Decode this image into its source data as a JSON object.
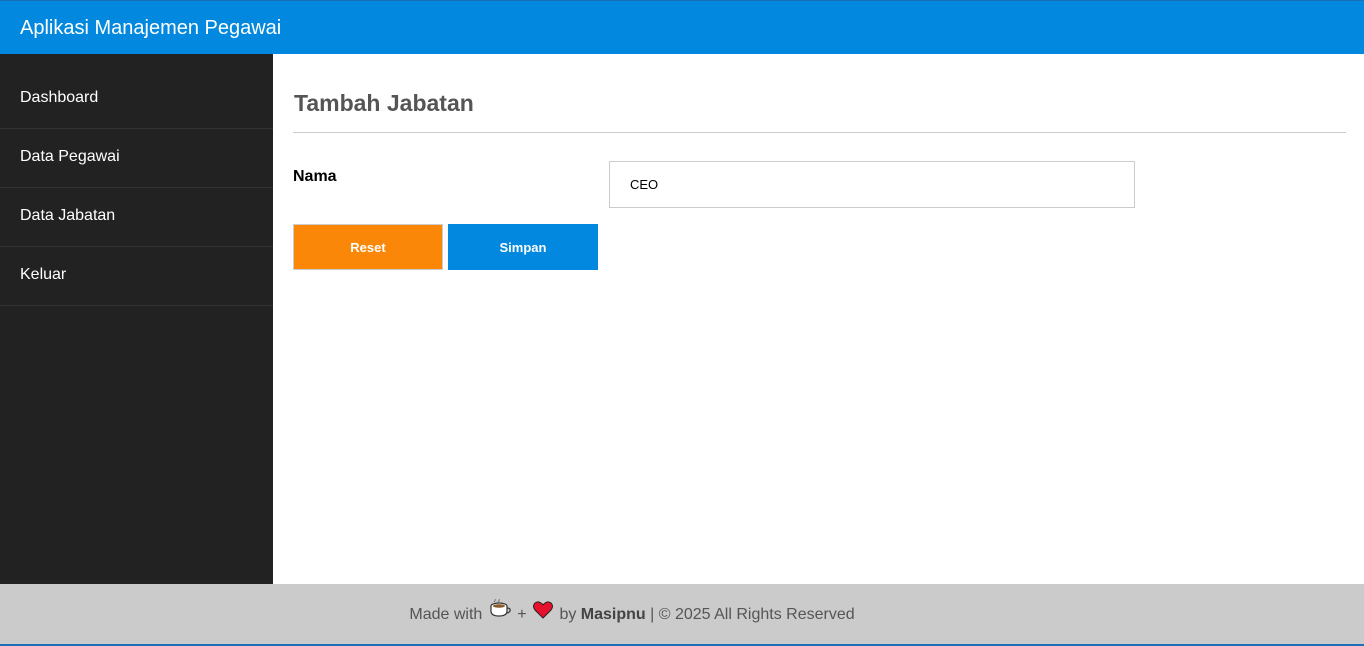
{
  "header": {
    "app_title": "Aplikasi Manajemen Pegawai"
  },
  "sidebar": {
    "items": [
      {
        "label": "Dashboard"
      },
      {
        "label": "Data Pegawai"
      },
      {
        "label": "Data Jabatan"
      },
      {
        "label": "Keluar"
      }
    ]
  },
  "main": {
    "page_title": "Tambah Jabatan",
    "form": {
      "nama_label": "Nama",
      "nama_value": "CEO"
    },
    "buttons": {
      "reset_label": "Reset",
      "save_label": "Simpan"
    }
  },
  "footer": {
    "made_with": "Made with",
    "plus": "+",
    "by": "by",
    "author": "Masipnu",
    "copyright": "| © 2025 All Rights Reserved",
    "icons": [
      "coffee-icon",
      "heart-icon"
    ]
  },
  "colors": {
    "header_bg": "#0288de",
    "sidebar_bg": "#222222",
    "reset_button": "#fb8708",
    "save_button": "#0288de",
    "footer_bg": "#cbcbcb"
  }
}
